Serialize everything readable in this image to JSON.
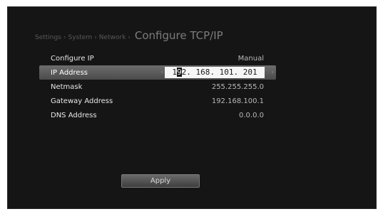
{
  "breadcrumb": {
    "items": [
      "Settings",
      "System",
      "Network"
    ],
    "separator": "›",
    "current": "Configure TCP/IP"
  },
  "form": {
    "rows": [
      {
        "label": "Configure IP",
        "value": "Manual"
      },
      {
        "label": "IP Address",
        "value": "192. 168. 101. 201"
      },
      {
        "label": "Netmask",
        "value": "255.255.255.0"
      },
      {
        "label": "Gateway Address",
        "value": "192.168.100.1"
      },
      {
        "label": "DNS Address",
        "value": "0.0.0.0"
      }
    ],
    "selected_index": 1,
    "edit": {
      "before_cursor": "1",
      "cursor_char": "9",
      "after_cursor": "2. 168. 101. 201"
    }
  },
  "icons": {
    "left_arrow": "‹",
    "right_arrow": "›"
  },
  "apply_label": "Apply",
  "colors": {
    "screen_background": "#151515",
    "selection_highlight": "#5a5a5a",
    "edit_box": "#f6f6f6"
  }
}
